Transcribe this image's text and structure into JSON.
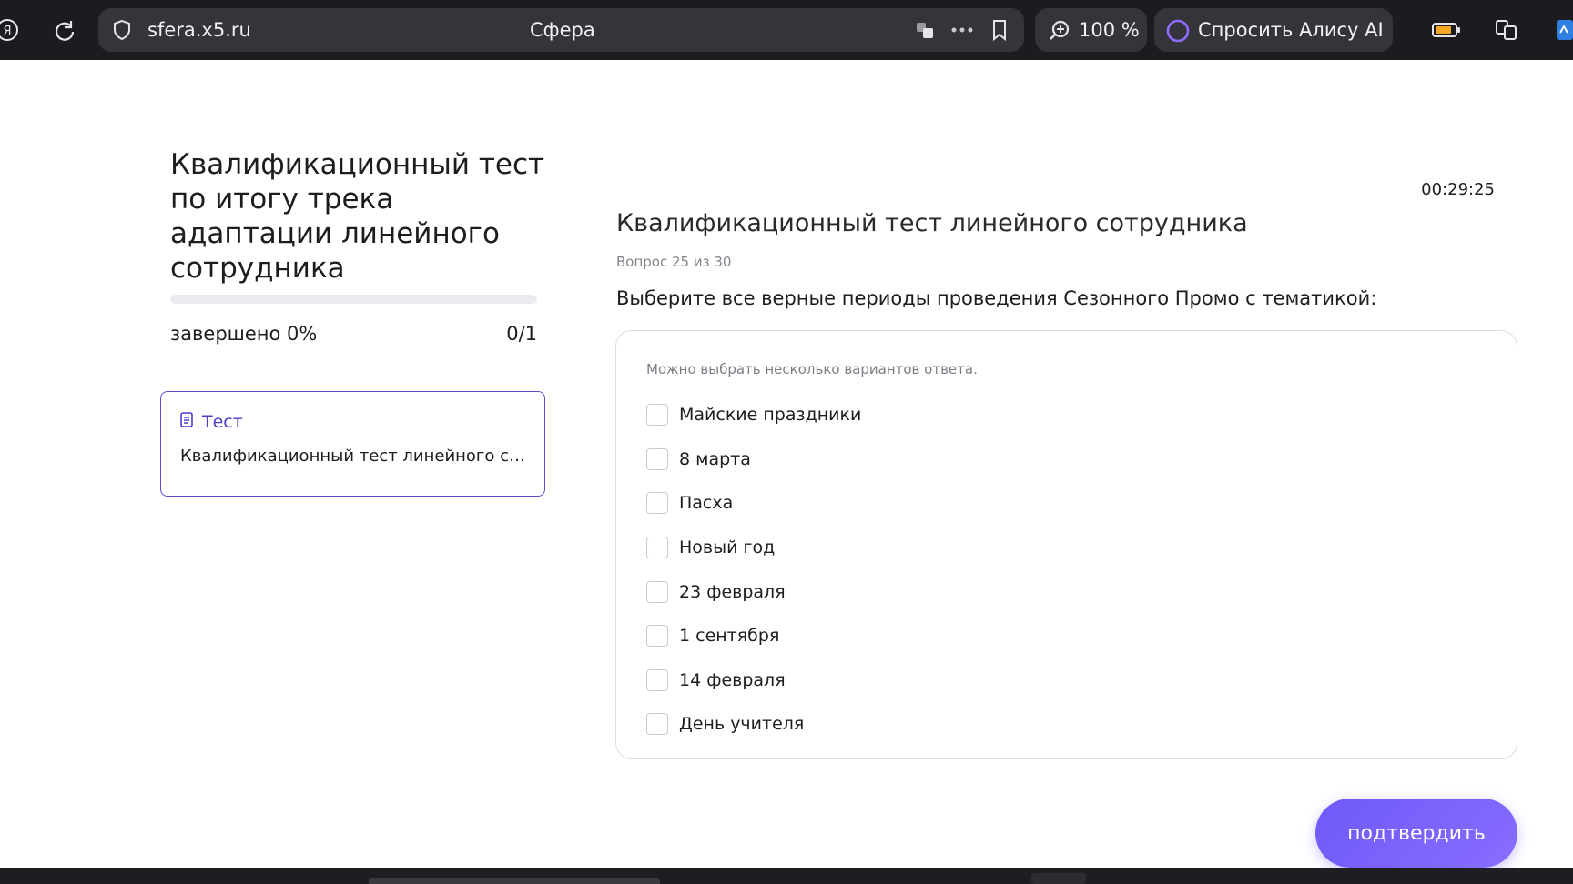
{
  "browser": {
    "url": "sfera.x5.ru",
    "tab_title": "Сфера",
    "zoom": "100 %",
    "alice_label": "Спросить Алису AI",
    "yandex_glyph": "Я",
    "icons": [
      "yandex-icon",
      "reload-icon",
      "shield-icon",
      "translate-icon",
      "more-icon",
      "bookmark-icon",
      "zoom-icon",
      "alice-icon",
      "battery-icon",
      "extensions-icon"
    ]
  },
  "track": {
    "title": "Квалификационный тест по итогу трека адаптации линейного сотрудника",
    "progress_label": "завершено 0%",
    "progress_count": "0/1",
    "progress_value": 0
  },
  "sidebar_card": {
    "tag": "Тест",
    "title": "Квалификационный тест линейного сотрудника"
  },
  "test": {
    "timer": "00:29:25",
    "heading": "Квалификационный тест линейного сотрудника",
    "question_counter": "Вопрос 25 из 30",
    "question_text": "Выберите все верные периоды проведения Сезонного Промо с тематикой:",
    "hint": "Можно выбрать несколько вариантов ответа.",
    "options": [
      {
        "label": "Майские праздники",
        "checked": false
      },
      {
        "label": "8 марта",
        "checked": false
      },
      {
        "label": "Пасха",
        "checked": false
      },
      {
        "label": "Новый год",
        "checked": false
      },
      {
        "label": "23 февраля",
        "checked": false
      },
      {
        "label": "1 сентября",
        "checked": false
      },
      {
        "label": "14 февраля",
        "checked": false
      },
      {
        "label": "День учителя",
        "checked": false
      }
    ],
    "confirm_label": "подтвердить"
  },
  "colors": {
    "accent": "#6d5af7",
    "card_border": "#5a4fc8",
    "topbar_bg": "#1b1b20"
  }
}
